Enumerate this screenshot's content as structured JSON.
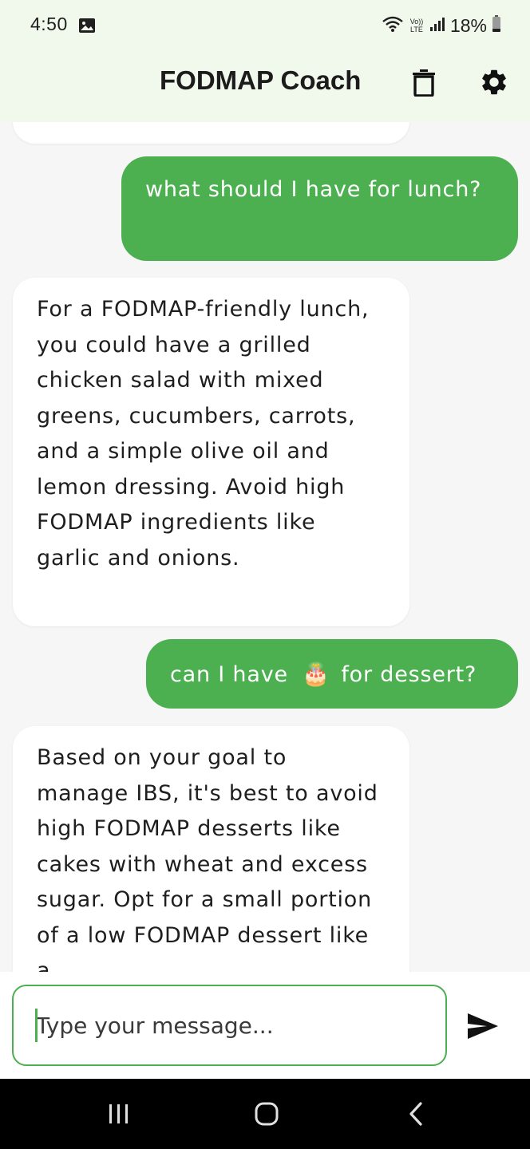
{
  "status_bar": {
    "time": "4:50",
    "network": "Vo)) LTE",
    "battery": "18%"
  },
  "app_bar": {
    "title": "FODMAP Coach",
    "icons": [
      "trash-icon",
      "gear-icon"
    ]
  },
  "messages": [
    {
      "role": "user",
      "text": "what should I have for lunch?"
    },
    {
      "role": "bot",
      "text": "For a FODMAP-friendly lunch, you could have a grilled chicken salad with mixed greens, cucumbers, carrots, and a simple olive oil and lemon dressing. Avoid high FODMAP ingredients like garlic and onions."
    },
    {
      "role": "user",
      "text_before": "can I have",
      "emoji": "🎂",
      "text_after": "for dessert?"
    },
    {
      "role": "bot",
      "text": "Based on your goal to manage IBS, it's best to avoid high FODMAP desserts like cakes with wheat and excess sugar. Opt for a small portion of a low FODMAP dessert like a"
    }
  ],
  "composer": {
    "placeholder": "Type your message...",
    "value": ""
  },
  "nav": {
    "icons": [
      "recent-apps-icon",
      "home-icon",
      "back-icon"
    ]
  },
  "colors": {
    "accent": "#4caf50",
    "header_bg": "#f1f8ec",
    "chat_bg": "#f6f6f6",
    "bot_bubble": "#ffffff"
  }
}
